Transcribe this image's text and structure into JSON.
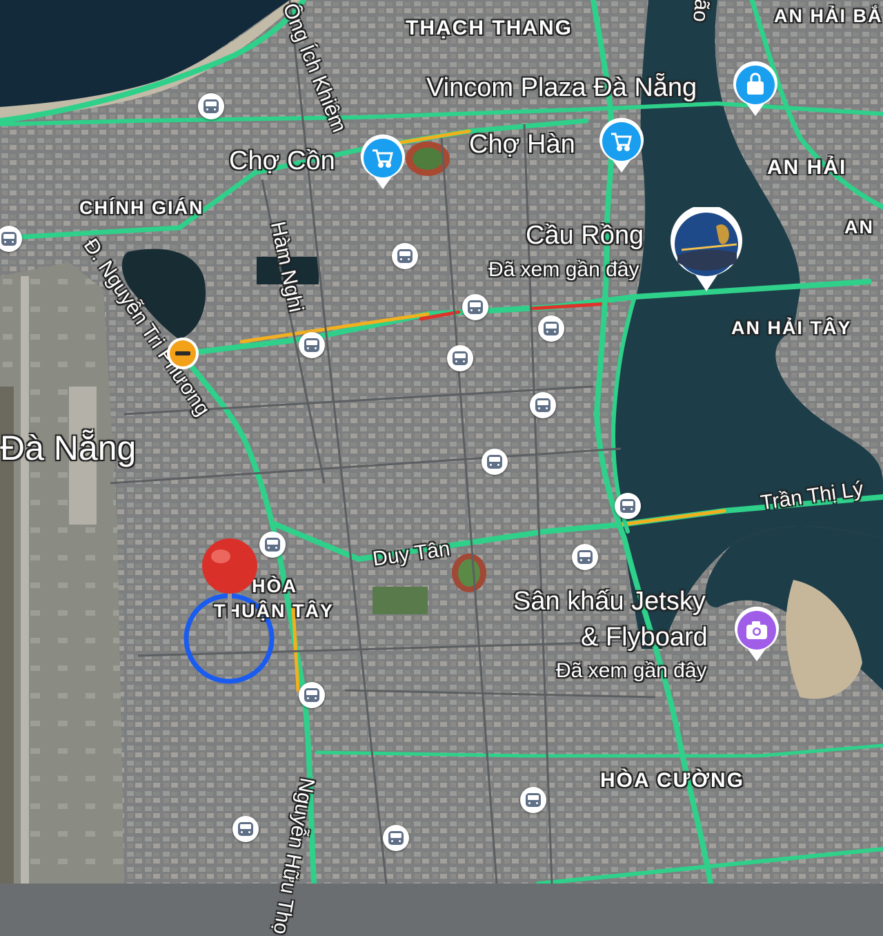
{
  "places": {
    "vincom": "Vincom Plaza Đà Nẵng",
    "cho_con": "Chợ Cồn",
    "cho_han": "Chợ Hàn",
    "cau_rong": "Cầu Rồng",
    "cau_rong_sub": "Đã xem gần đây",
    "jetsky_line1": "Sân khấu Jetsky",
    "jetsky_line2": "& Flyboard",
    "jetsky_sub": "Đã xem gần đây"
  },
  "districts": {
    "thach_thang": "THẠCH THANG",
    "an_hai_bac": "AN HẢI BẮ",
    "an_hai": "AN HẢI",
    "an_right": "AN",
    "chinh_gian": "CHÍNH GIÁN",
    "an_hai_tay": "AN HẢI TÂY",
    "hoa_thuan_tay_1": "HÒA",
    "hoa_thuan_tay_2": "THUẬN TÂY",
    "hoa_cuong": "HÒA CƯỜNG"
  },
  "city": "Đà Nẵng",
  "roads": {
    "ong_ich_khiem": "Ông Ích Khiêm",
    "ham_nghi": "Hàm Nghi",
    "nguyen_tri_phuong": "Đ. Nguyễn Tri Phương",
    "duy_tan": "Duy Tân",
    "tran_thi_ly": "Trần Thị Lý",
    "hoa_top": "ão",
    "nguyen_huu_tho": "Nguyễn Hữu Thọ"
  },
  "colors": {
    "traffic_green": "#2fd08a",
    "traffic_yellow": "#f2b01e",
    "traffic_red": "#e0322a",
    "shopping_pin": "#1a9ff0",
    "photo_pin": "#a05ee8",
    "location_ring": "#1a5cf0",
    "dropped_pin": "#d9312a",
    "closure_icon": "#f4a11a"
  },
  "icons": {
    "transit": "bus-icon",
    "shopping_bag": "shopping-bag-icon",
    "cart": "cart-icon",
    "camera": "camera-icon",
    "road_closed": "road-closed-icon"
  }
}
